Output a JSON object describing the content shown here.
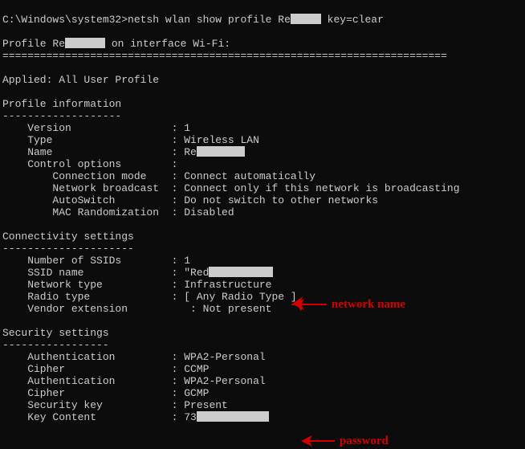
{
  "prompt": {
    "path": "C:\\Windows\\system32>",
    "cmd_pre": "netsh wlan show profile Re",
    "cmd_post": " key=clear"
  },
  "profile_line": {
    "prefix": "Profile Re",
    "suffix": "on interface Wi-Fi:"
  },
  "ruler": "=======================================================================",
  "applied": "Applied: All User Profile",
  "sections": {
    "profile_info_title": "Profile information",
    "dashes": "-------------------",
    "version_k": "    Version                : ",
    "version_v": "1",
    "type_k": "    Type                   : ",
    "type_v": "Wireless LAN",
    "name_k": "    Name                   : ",
    "name_prefix": "Re",
    "control_k": "    Control options        :",
    "conn_mode_k": "        Connection mode    : ",
    "conn_mode_v": "Connect automatically",
    "net_bcast_k": "        Network broadcast  : ",
    "net_bcast_v": "Connect only if this network is broadcasting",
    "autoswitch_k": "        AutoSwitch         : ",
    "autoswitch_v": "Do not switch to other networks",
    "mac_k": "        MAC Randomization  : ",
    "mac_v": "Disabled",
    "conn_settings_title": "Connectivity settings",
    "dashes2": "---------------------",
    "num_ssids_k": "    Number of SSIDs        : ",
    "num_ssids_v": "1",
    "ssid_k": "    SSID name              : ",
    "ssid_prefix": "\"Red",
    "net_type_k": "    Network type           : ",
    "net_type_v": "Infrastructure",
    "radio_k": "    Radio type             : ",
    "radio_v": "[ Any Radio Type ]",
    "vendor_k": "    Vendor extension          : ",
    "vendor_v": "Not present",
    "sec_title": "Security settings",
    "dashes3": "-----------------",
    "auth1_k": "    Authentication         : ",
    "auth1_v": "WPA2-Personal",
    "cipher1_k": "    Cipher                 : ",
    "cipher1_v": "CCMP",
    "auth2_k": "    Authentication         : ",
    "auth2_v": "WPA2-Personal",
    "cipher2_k": "    Cipher                 : ",
    "cipher2_v": "GCMP",
    "seckey_k": "    Security key           : ",
    "seckey_v": "Present",
    "keycontent_k": "    Key Content            : ",
    "keycontent_prefix": "73"
  },
  "annotations": {
    "network_name": "network name",
    "password": "password"
  }
}
